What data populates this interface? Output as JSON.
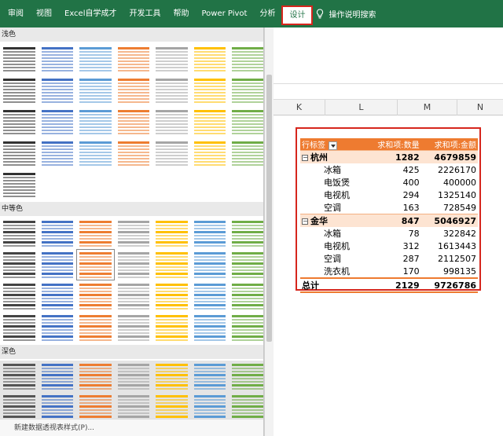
{
  "ribbon": {
    "tabs": [
      "审阅",
      "视图",
      "Excel自学成才",
      "开发工具",
      "帮助",
      "Power Pivot",
      "分析",
      "设计"
    ],
    "active_tab": "设计",
    "tell_me": "操作说明搜索",
    "accent": "#217346",
    "highlight": "#d6261d"
  },
  "gallery": {
    "sections": [
      {
        "title": "浅色",
        "rows": 5
      },
      {
        "title": "中等色",
        "rows": 4
      },
      {
        "title": "深色",
        "rows": 2
      }
    ],
    "new_style_label": "新建数据透视表样式(P)..."
  },
  "sheet": {
    "columns": [
      "K",
      "L",
      "M",
      "N"
    ]
  },
  "pivot": {
    "headers": [
      "行标签",
      "求和项:数量",
      "求和项:金额"
    ],
    "groups": [
      {
        "name": "杭州",
        "qty": "1282",
        "amount": "4679859",
        "items": [
          {
            "name": "冰箱",
            "qty": "425",
            "amount": "2226170"
          },
          {
            "name": "电饭煲",
            "qty": "400",
            "amount": "400000"
          },
          {
            "name": "电视机",
            "qty": "294",
            "amount": "1325140"
          },
          {
            "name": "空调",
            "qty": "163",
            "amount": "728549"
          }
        ]
      },
      {
        "name": "金华",
        "qty": "847",
        "amount": "5046927",
        "items": [
          {
            "name": "冰箱",
            "qty": "78",
            "amount": "322842"
          },
          {
            "name": "电视机",
            "qty": "312",
            "amount": "1613443"
          },
          {
            "name": "空调",
            "qty": "287",
            "amount": "2112507"
          },
          {
            "name": "洗衣机",
            "qty": "170",
            "amount": "998135"
          }
        ]
      }
    ],
    "total": {
      "label": "总计",
      "qty": "2129",
      "amount": "9726786"
    },
    "header_color": "#ee7b30",
    "group_color": "#fde4d2"
  }
}
